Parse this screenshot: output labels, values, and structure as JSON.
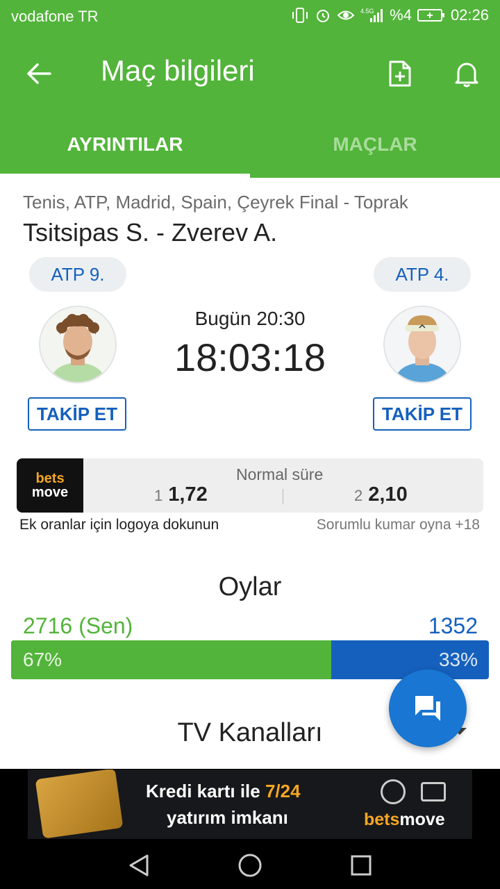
{
  "status_bar": {
    "carrier": "vodafone TR",
    "network": "4.5G",
    "battery": "%4",
    "time": "02:26",
    "icons": [
      "vibrate-icon",
      "alarm-icon",
      "eye-icon",
      "signal-icon",
      "battery-icon"
    ]
  },
  "app_bar": {
    "title": "Maç bilgileri",
    "icons": [
      "back-arrow-icon",
      "add-document-icon",
      "bell-icon"
    ]
  },
  "tabs": [
    {
      "label": "AYRINTILAR",
      "active": true
    },
    {
      "label": "MAÇLAR",
      "active": false
    }
  ],
  "match": {
    "breadcrumb": "Tenis, ATP, Madrid, Spain, Çeyrek Final - Toprak",
    "title": "Tsitsipas S. - Zverev A.",
    "player_left": {
      "rank": "ATP 9.",
      "follow_label": "TAKİP ET"
    },
    "player_right": {
      "rank": "ATP 4.",
      "follow_label": "TAKİP ET"
    },
    "start_time": "Bugün 20:30",
    "countdown": "18:03:18"
  },
  "odds": {
    "logo_line1": "bets",
    "logo_line2": "move",
    "label": "Normal süre",
    "outcome1_num": "1",
    "outcome1_value": "1,72",
    "outcome2_num": "2",
    "outcome2_value": "2,10",
    "note_left": "Ek oranlar için logoya dokunun",
    "note_right": "Sorumlu kumar oyna +18"
  },
  "votes": {
    "title": "Oylar",
    "left_count": "2716 (Sen)",
    "right_count": "1352",
    "left_percent": "67%",
    "right_percent": "33%",
    "left_fraction": 0.67,
    "left_color": "#52b43a",
    "right_color": "#1560bd"
  },
  "tv": {
    "title": "TV Kanalları"
  },
  "ad": {
    "line1_a": "Kredi kartı ile ",
    "line1_b": "7/24",
    "line2": "yatırım imkanı",
    "brand_a": "bets",
    "brand_b": "move"
  },
  "colors": {
    "primary_green": "#52b43a",
    "accent_blue": "#1560bd",
    "fab_blue": "#1976d2"
  }
}
